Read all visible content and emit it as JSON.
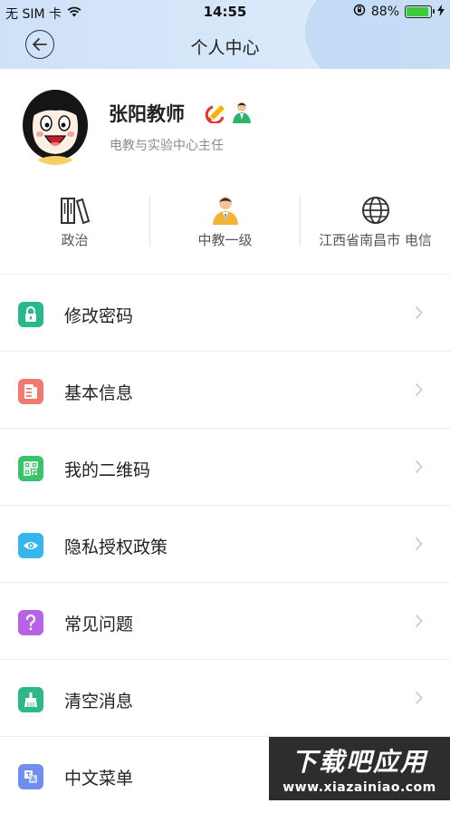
{
  "status_bar": {
    "carrier": "无 SIM 卡",
    "time": "14:55",
    "battery": "88%",
    "battery_level": 0.88
  },
  "nav": {
    "title": "个人中心"
  },
  "profile": {
    "name": "张阳教师",
    "subtitle": "电教与实验中心主任",
    "stats": [
      {
        "icon": "books-icon",
        "label": "政治"
      },
      {
        "icon": "person-icon",
        "label": "中教一级"
      },
      {
        "icon": "globe-icon",
        "label": "江西省南昌市 电信"
      }
    ]
  },
  "menu": [
    {
      "label": "修改密码",
      "icon": "lock-icon",
      "color": "#27b98c"
    },
    {
      "label": "基本信息",
      "icon": "document-icon",
      "color": "#f07a6e"
    },
    {
      "label": "我的二维码",
      "icon": "qrcode-icon",
      "color": "#3cc26a"
    },
    {
      "label": "隐私授权政策",
      "icon": "eye-icon",
      "color": "#35b7ee"
    },
    {
      "label": "常见问题",
      "icon": "question-icon",
      "color": "#b862e6"
    },
    {
      "label": "清空消息",
      "icon": "broom-icon",
      "color": "#2cb889"
    },
    {
      "label": "中文菜单",
      "icon": "translate-icon",
      "color": "#6f8ff0"
    }
  ],
  "watermark": {
    "main": "下载吧应用",
    "sub": "www.xiazainiao.com"
  }
}
